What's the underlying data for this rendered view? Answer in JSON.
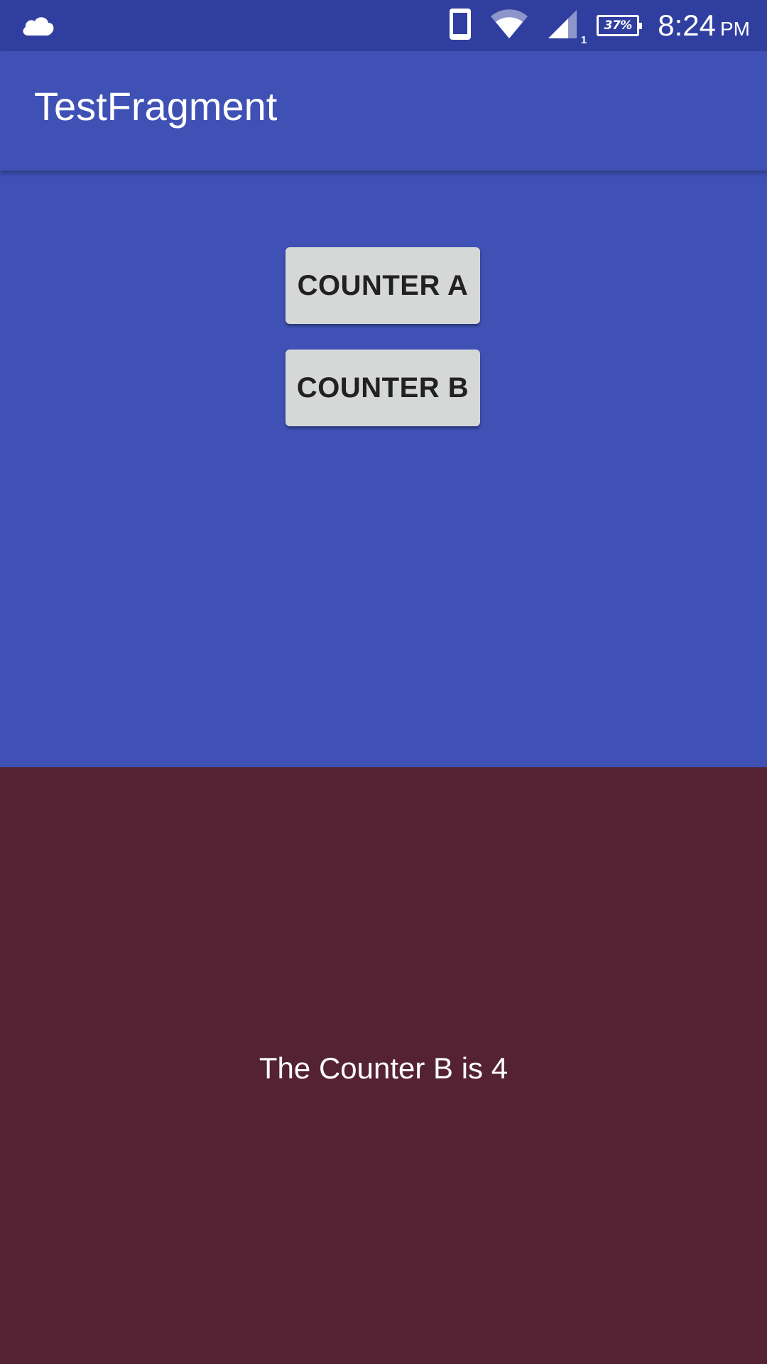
{
  "status_bar": {
    "icons": [
      "cloud-icon",
      "phone-icon",
      "wifi-icon",
      "signal-icon",
      "battery-icon"
    ],
    "signal_sim": "1",
    "battery_percent": "37%",
    "time": "8:24",
    "ampm": "PM"
  },
  "app_bar": {
    "title": "TestFragment"
  },
  "fragment_a": {
    "counter_a_label": "COUNTER A",
    "counter_b_label": "COUNTER B"
  },
  "fragment_b": {
    "counter_text": "The Counter B is 4"
  },
  "colors": {
    "status_bar": "#303f9f",
    "primary": "#3f51b5",
    "button": "#d6d7d7",
    "fragment_b_bg": "#542233"
  }
}
